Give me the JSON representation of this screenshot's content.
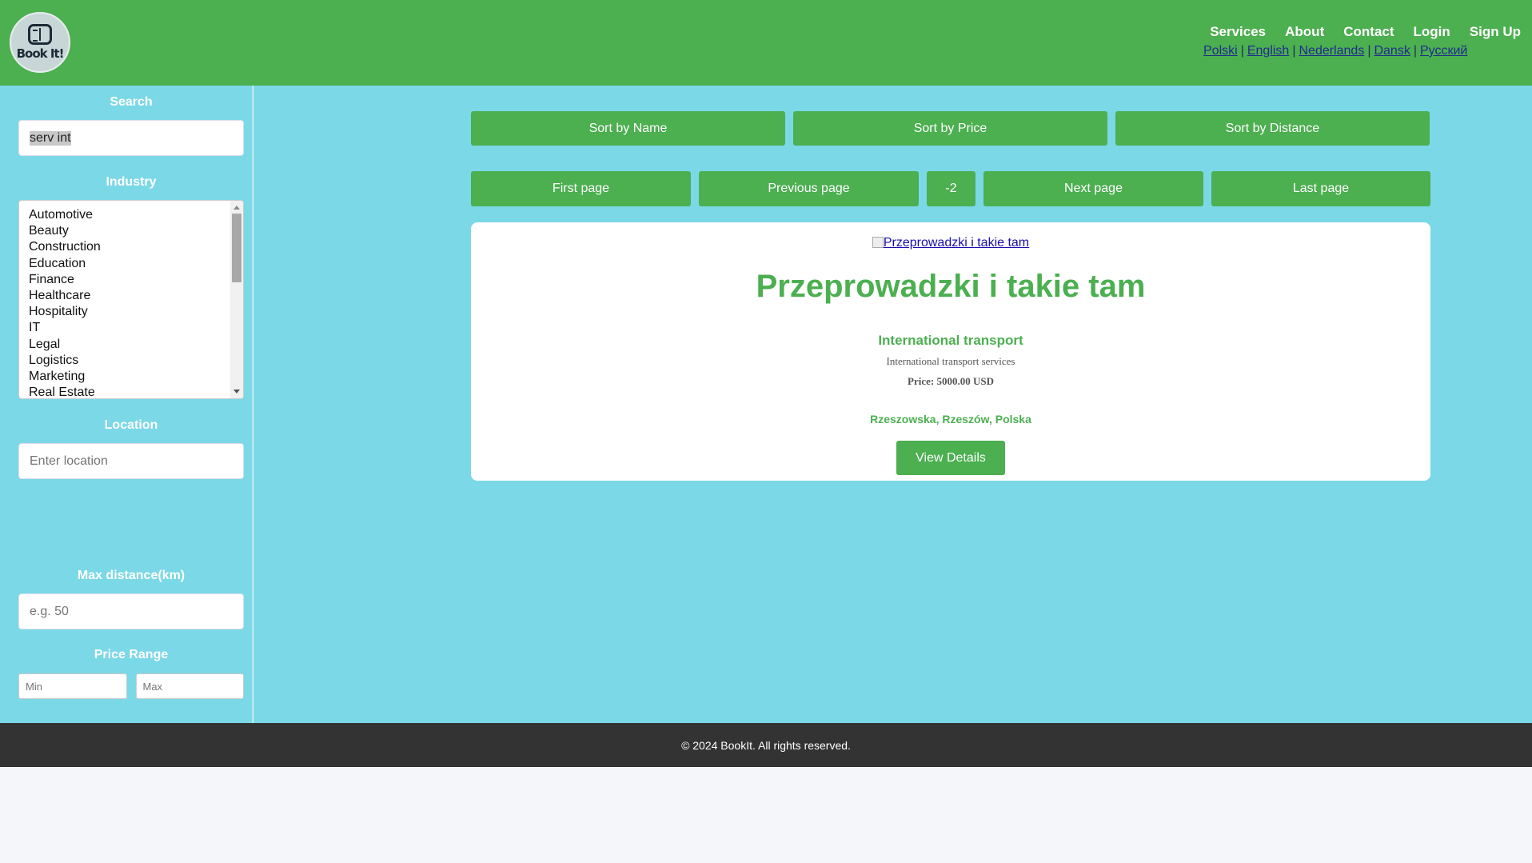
{
  "header": {
    "logo_text": "Book It!",
    "nav": [
      "Services",
      "About",
      "Contact",
      "Login",
      "Sign Up"
    ],
    "languages": [
      "Polski",
      "English",
      "Nederlands",
      "Dansk",
      "Русский"
    ],
    "lang_separator": "|"
  },
  "sidebar": {
    "search_label": "Search",
    "search_value": "serv int",
    "industry_label": "Industry",
    "industries": [
      "Automotive",
      "Beauty",
      "Construction",
      "Education",
      "Finance",
      "Healthcare",
      "Hospitality",
      "IT",
      "Legal",
      "Logistics",
      "Marketing",
      "Real Estate"
    ],
    "location_label": "Location",
    "location_placeholder": "Enter location",
    "distance_label": "Max distance(km)",
    "distance_placeholder": "e.g. 50",
    "price_label": "Price Range",
    "price_min_placeholder": "Min",
    "price_max_placeholder": "Max"
  },
  "sorting": {
    "by_name": "Sort by Name",
    "by_price": "Sort by Price",
    "by_distance": "Sort by Distance"
  },
  "pagination": {
    "first": "First page",
    "previous": "Previous page",
    "current": "-2",
    "next": "Next page",
    "last": "Last page"
  },
  "listing": {
    "image_alt": "Przeprowadzki i takie tam",
    "title": "Przeprowadzki i takie tam",
    "service": "International transport",
    "description": "International transport services",
    "price": "Price: 5000.00 USD",
    "location": "Rzeszowska, Rzeszów, Polska",
    "details_button": "View Details"
  },
  "footer": {
    "copyright": "© 2024 BookIt. All rights reserved."
  },
  "colors": {
    "primary_green": "#4caf50",
    "background_cyan": "#7bd8e6",
    "footer_dark": "#333333"
  }
}
